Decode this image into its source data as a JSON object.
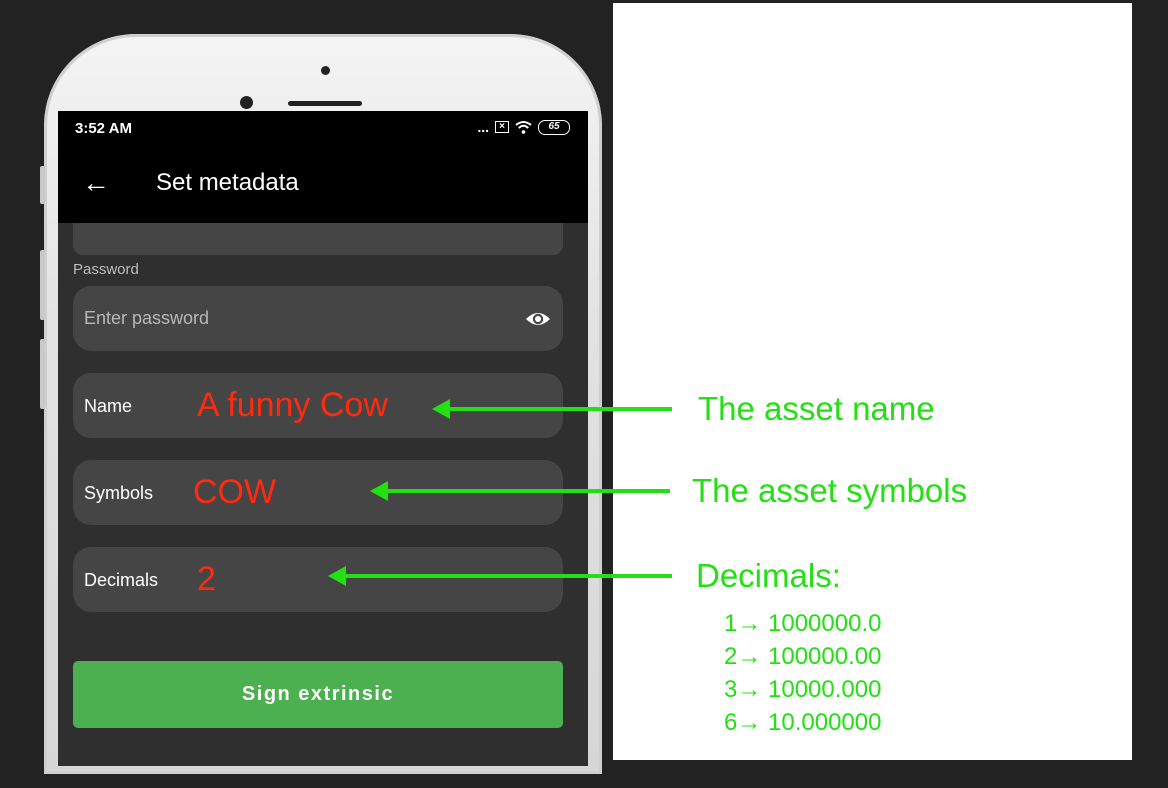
{
  "status_bar": {
    "time": "3:52 AM",
    "dots": "...",
    "battery": "65"
  },
  "app_bar": {
    "back_icon": "arrow-left-icon",
    "title": "Set metadata"
  },
  "password": {
    "label": "Password",
    "placeholder": "Enter password",
    "toggle_icon": "eye-icon"
  },
  "fields": {
    "name": {
      "label": "Name",
      "value": "A funny Cow"
    },
    "symbols": {
      "label": "Symbols",
      "value": "COW"
    },
    "decimals": {
      "label": "Decimals",
      "value": "2"
    }
  },
  "sign_button": {
    "label": "Sign extrinsic"
  },
  "annotations": {
    "name": "The asset name",
    "symbols": "The asset symbols",
    "decimals": "Decimals:",
    "decimal_examples": [
      "1→ 1000000.0",
      "2→ 100000.00",
      "3→ 10000.000",
      "6→ 10.000000"
    ]
  },
  "colors": {
    "annotation": "#22e011",
    "input_value": "#ff2a10",
    "button": "#4caf50"
  }
}
